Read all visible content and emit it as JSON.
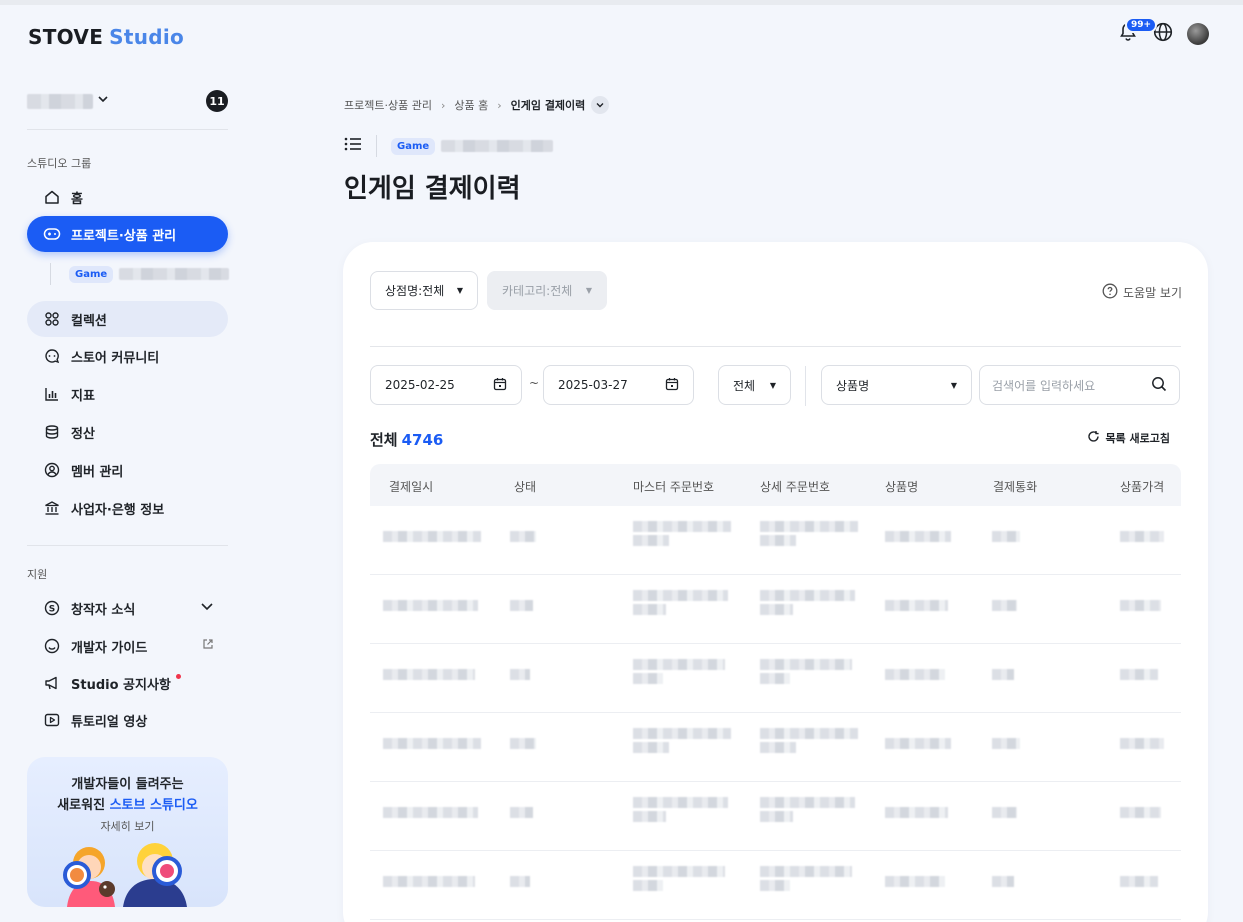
{
  "header": {
    "logo_part1": "STOVE",
    "logo_part2": "Studio",
    "notification_badge": "99+"
  },
  "sidebar": {
    "workspace_count": "11",
    "section_studio": "스튜디오 그룹",
    "items": [
      {
        "label": "홈",
        "icon": "home-icon"
      },
      {
        "label": "프로젝트·상품 관리",
        "icon": "gamepad-icon"
      },
      {
        "label": "컬렉션",
        "icon": "collection-icon"
      },
      {
        "label": "스토어 커뮤니티",
        "icon": "chat-icon"
      },
      {
        "label": "지표",
        "icon": "chart-icon"
      },
      {
        "label": "정산",
        "icon": "database-icon"
      },
      {
        "label": "멤버 관리",
        "icon": "user-icon"
      },
      {
        "label": "사업자·은행 정보",
        "icon": "bank-icon"
      }
    ],
    "sub_tag": "Game",
    "section_support": "지원",
    "support_items": [
      {
        "label": "창작자 소식",
        "icon": "dollar-icon"
      },
      {
        "label": "개발자 가이드",
        "icon": "smile-icon"
      },
      {
        "label": "Studio 공지사항",
        "icon": "megaphone-icon"
      },
      {
        "label": "튜토리얼 영상",
        "icon": "play-icon"
      }
    ],
    "promo": {
      "line1": "개발자들이 들려주는",
      "line2_prefix": "새로워진 ",
      "line2_accent": "스토브 스튜디오",
      "more": "자세히 보기"
    }
  },
  "breadcrumb": {
    "item1": "프로젝트·상품 관리",
    "item2": "상품 홈",
    "current": "인게임 결제이력"
  },
  "page": {
    "game_tag": "Game",
    "title": "인게임 결제이력"
  },
  "filters": {
    "store_select": "상점명:전체",
    "category_select": "카테고리:전체",
    "help": "도움말 보기",
    "date_from": "2025-02-25",
    "date_to": "2025-03-27",
    "tilde": "~",
    "status_select": "전체",
    "search_field_select": "상품명",
    "search_placeholder": "검색어를 입력하세요"
  },
  "list": {
    "total_label": "전체",
    "total_count": "4746",
    "refresh_label": "목록 새로고침",
    "columns": [
      "결제일시",
      "상태",
      "마스터 주문번호",
      "상세 주문번호",
      "상품명",
      "결제통화",
      "상품가격"
    ]
  },
  "colors": {
    "accent": "#1b5cf4",
    "background": "#f3f6fc",
    "badge_red": "#f0344b"
  }
}
